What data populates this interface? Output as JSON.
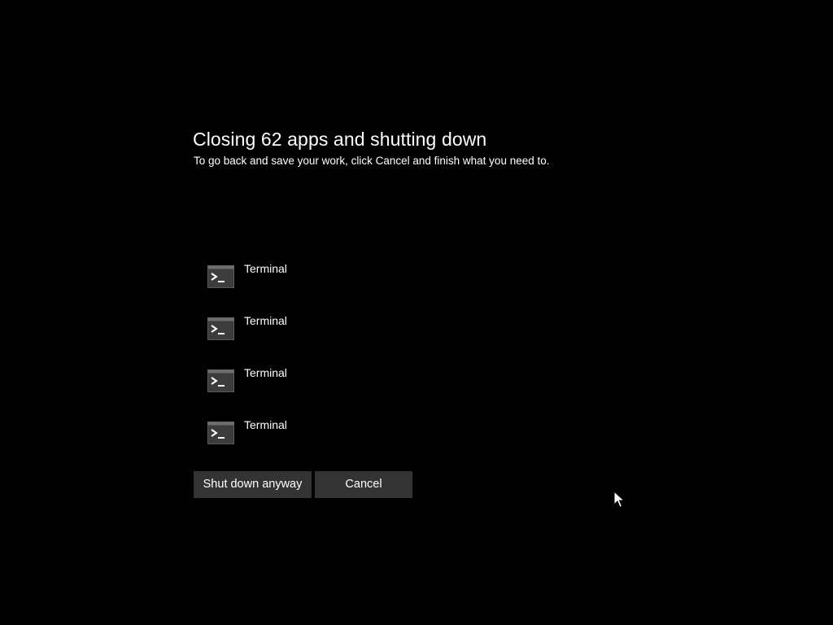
{
  "dialog": {
    "title": "Closing 62 apps and shutting down",
    "subtitle": "To go back and save your work, click Cancel and finish what you need to."
  },
  "apps": [
    {
      "name": "Terminal",
      "icon": "terminal-icon"
    },
    {
      "name": "Terminal",
      "icon": "terminal-icon"
    },
    {
      "name": "Terminal",
      "icon": "terminal-icon"
    },
    {
      "name": "Terminal",
      "icon": "terminal-icon"
    }
  ],
  "buttons": {
    "shutdown_label": "Shut down anyway",
    "cancel_label": "Cancel"
  },
  "colors": {
    "background": "#000000",
    "text": "#ffffff",
    "button_bg": "#333333"
  }
}
